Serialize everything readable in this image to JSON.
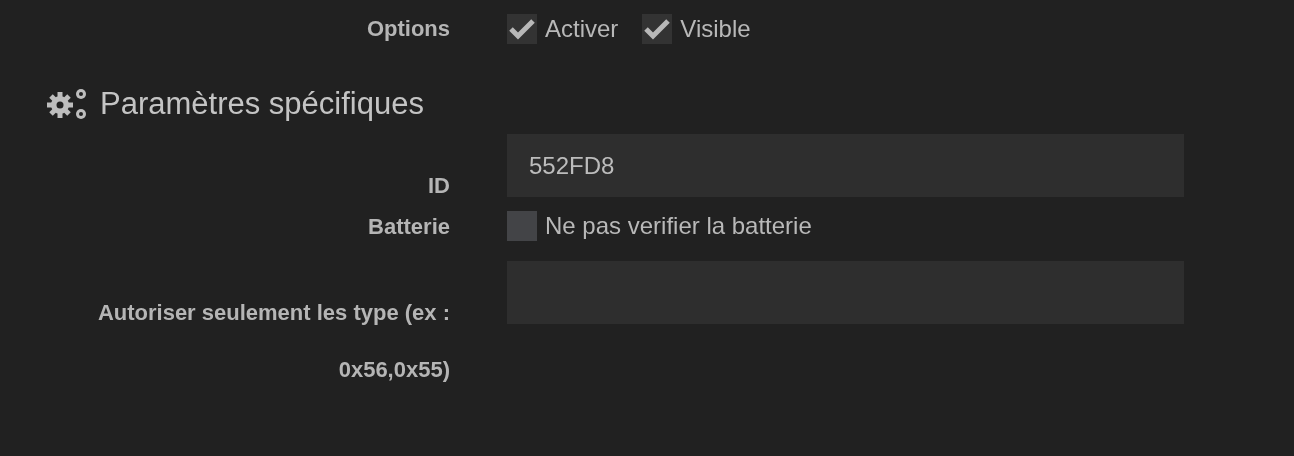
{
  "options_row": {
    "label": "Options",
    "checkboxes": [
      {
        "label": "Activer",
        "checked": true
      },
      {
        "label": "Visible",
        "checked": true
      }
    ]
  },
  "section": {
    "title": "Paramètres spécifiques"
  },
  "fields": [
    {
      "kind": "text",
      "label": "ID",
      "value": "552FD8"
    },
    {
      "kind": "checkbox",
      "label": "Batterie",
      "checkbox_label": "Ne pas verifier la batterie",
      "checked": false
    },
    {
      "kind": "text",
      "label": "Autoriser seulement les type (ex : 0x56,0x55)"
    }
  ]
}
